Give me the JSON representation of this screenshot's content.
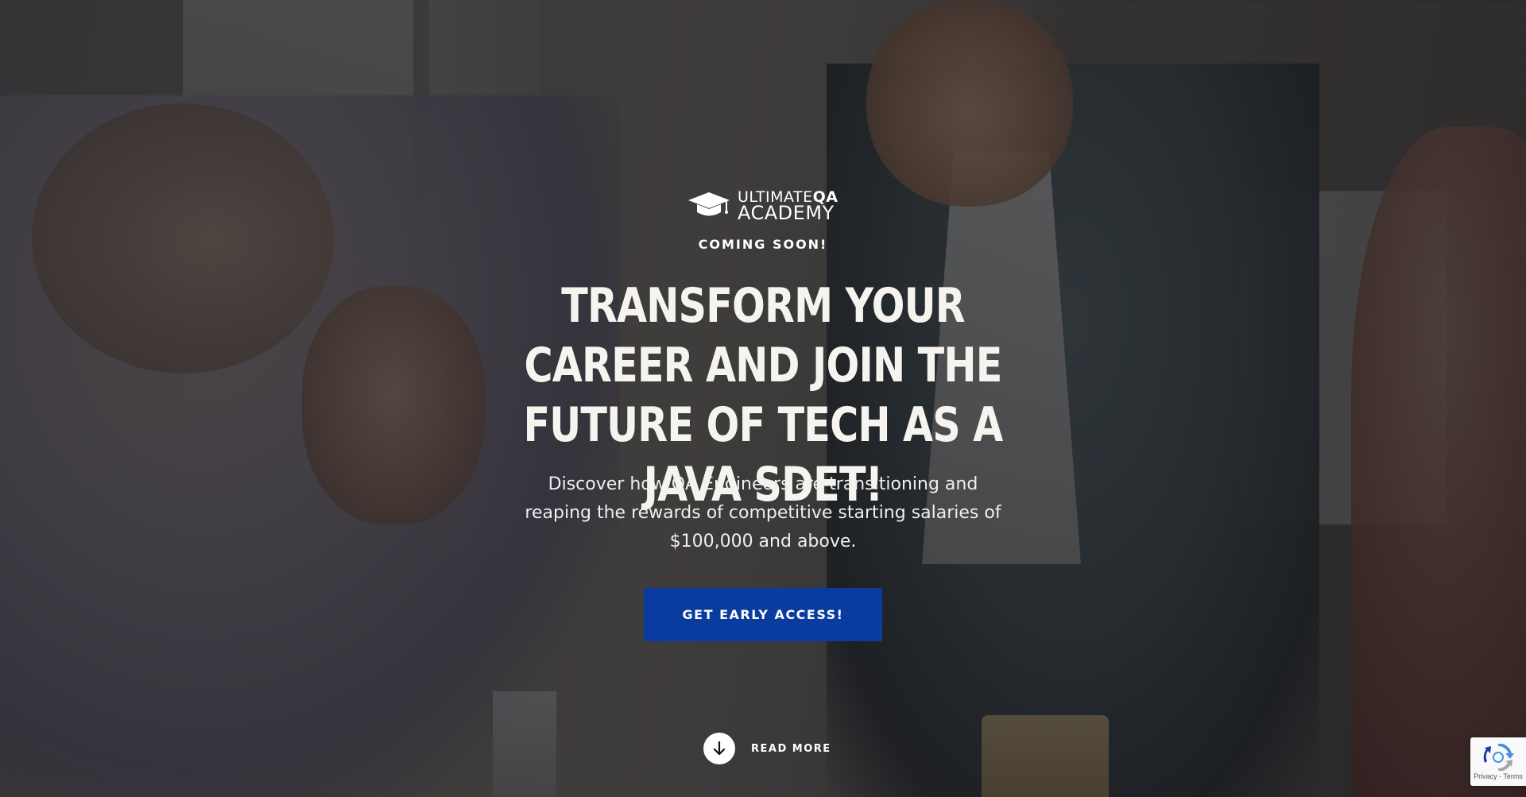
{
  "logo": {
    "line1_normal": "ULTIMATE",
    "line1_bold": "QA",
    "line2": "ACADEMY",
    "icon": "graduation-cap-icon"
  },
  "hero": {
    "eyebrow": "COMING SOON!",
    "headline": "TRANSFORM YOUR CAREER AND JOIN THE FUTURE OF TECH AS A JAVA SDET!",
    "subtext": "Discover how QA Engineers are transitioning and reaping the rewards of competitive starting salaries of $100,000 and above.",
    "cta_label": "GET EARLY ACCESS!",
    "read_more_label": "READ MORE",
    "read_more_icon": "arrow-down-icon"
  },
  "recaptcha": {
    "links": "Privacy - Terms",
    "icon": "recaptcha-icon"
  },
  "colors": {
    "cta_background": "#0a3b9f",
    "text": "#ffffff",
    "overlay": "rgba(18,18,22,0.62)"
  }
}
